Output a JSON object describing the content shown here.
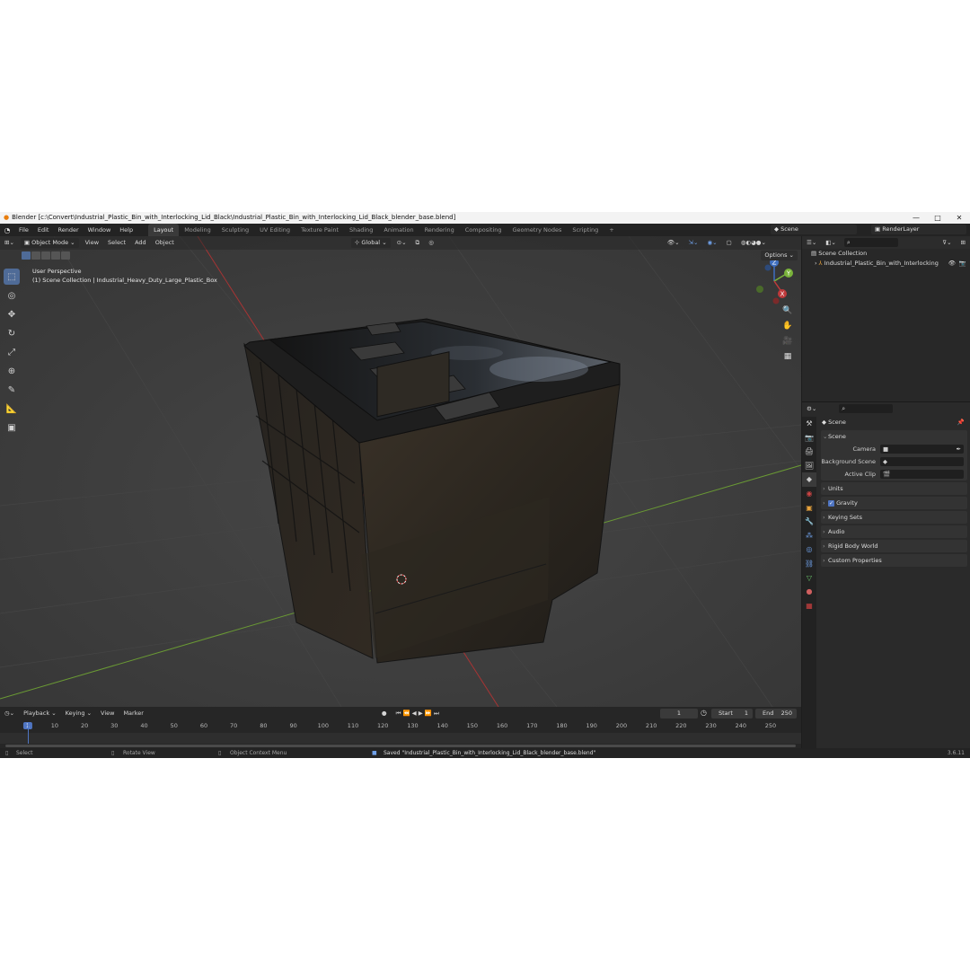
{
  "window": {
    "title": "Blender [c:\\Convert\\Industrial_Plastic_Bin_with_Interlocking_Lid_Black\\Industrial_Plastic_Bin_with_Interlocking_Lid_Black_blender_base.blend]",
    "minimize": "—",
    "maximize": "□",
    "close": "✕"
  },
  "menubar": {
    "items": [
      "File",
      "Edit",
      "Render",
      "Window",
      "Help"
    ],
    "tabs": [
      "Layout",
      "Modeling",
      "Sculpting",
      "UV Editing",
      "Texture Paint",
      "Shading",
      "Animation",
      "Rendering",
      "Compositing",
      "Geometry Nodes",
      "Scripting"
    ],
    "add_tab": "+",
    "scene": "Scene",
    "view_layer": "RenderLayer"
  },
  "viewport": {
    "mode": "Object Mode",
    "menus": [
      "View",
      "Select",
      "Add",
      "Object"
    ],
    "orientation": "Global",
    "perspective_label": "User Perspective",
    "collection_label": "(1) Scene Collection | Industrial_Heavy_Duty_Large_Plastic_Box",
    "options": "Options",
    "gizmo": {
      "x": "X",
      "y": "Y",
      "z": "Z"
    },
    "colors": {
      "background": "#3d3d3d",
      "x_axis": "#c0393b",
      "y_axis": "#7ab33b"
    }
  },
  "timeline": {
    "menus": [
      "Playback",
      "Keying",
      "View",
      "Marker"
    ],
    "current_frame": "1",
    "start_label": "Start",
    "start": "1",
    "end_label": "End",
    "end": "250",
    "ruler": [
      "1",
      "10",
      "20",
      "30",
      "40",
      "50",
      "60",
      "70",
      "80",
      "90",
      "100",
      "110",
      "120",
      "130",
      "140",
      "150",
      "160",
      "170",
      "180",
      "190",
      "200",
      "210",
      "220",
      "230",
      "240",
      "250"
    ]
  },
  "statusbar": {
    "select": "Select",
    "rotate": "Rotate View",
    "context_menu": "Object Context Menu",
    "message": "Saved \"Industrial_Plastic_Bin_with_Interlocking_Lid_Black_blender_base.blend\"",
    "version": "3.6.11"
  },
  "outliner": {
    "root": "Scene Collection",
    "item": "Industrial_Plastic_Bin_with_Interlocking"
  },
  "properties": {
    "title": "Scene",
    "scene_panel": "Scene",
    "camera_label": "Camera",
    "background_label": "Background Scene",
    "clip_label": "Active Clip",
    "panels": [
      "Units",
      "Gravity",
      "Keying Sets",
      "Audio",
      "Rigid Body World",
      "Custom Properties"
    ]
  }
}
